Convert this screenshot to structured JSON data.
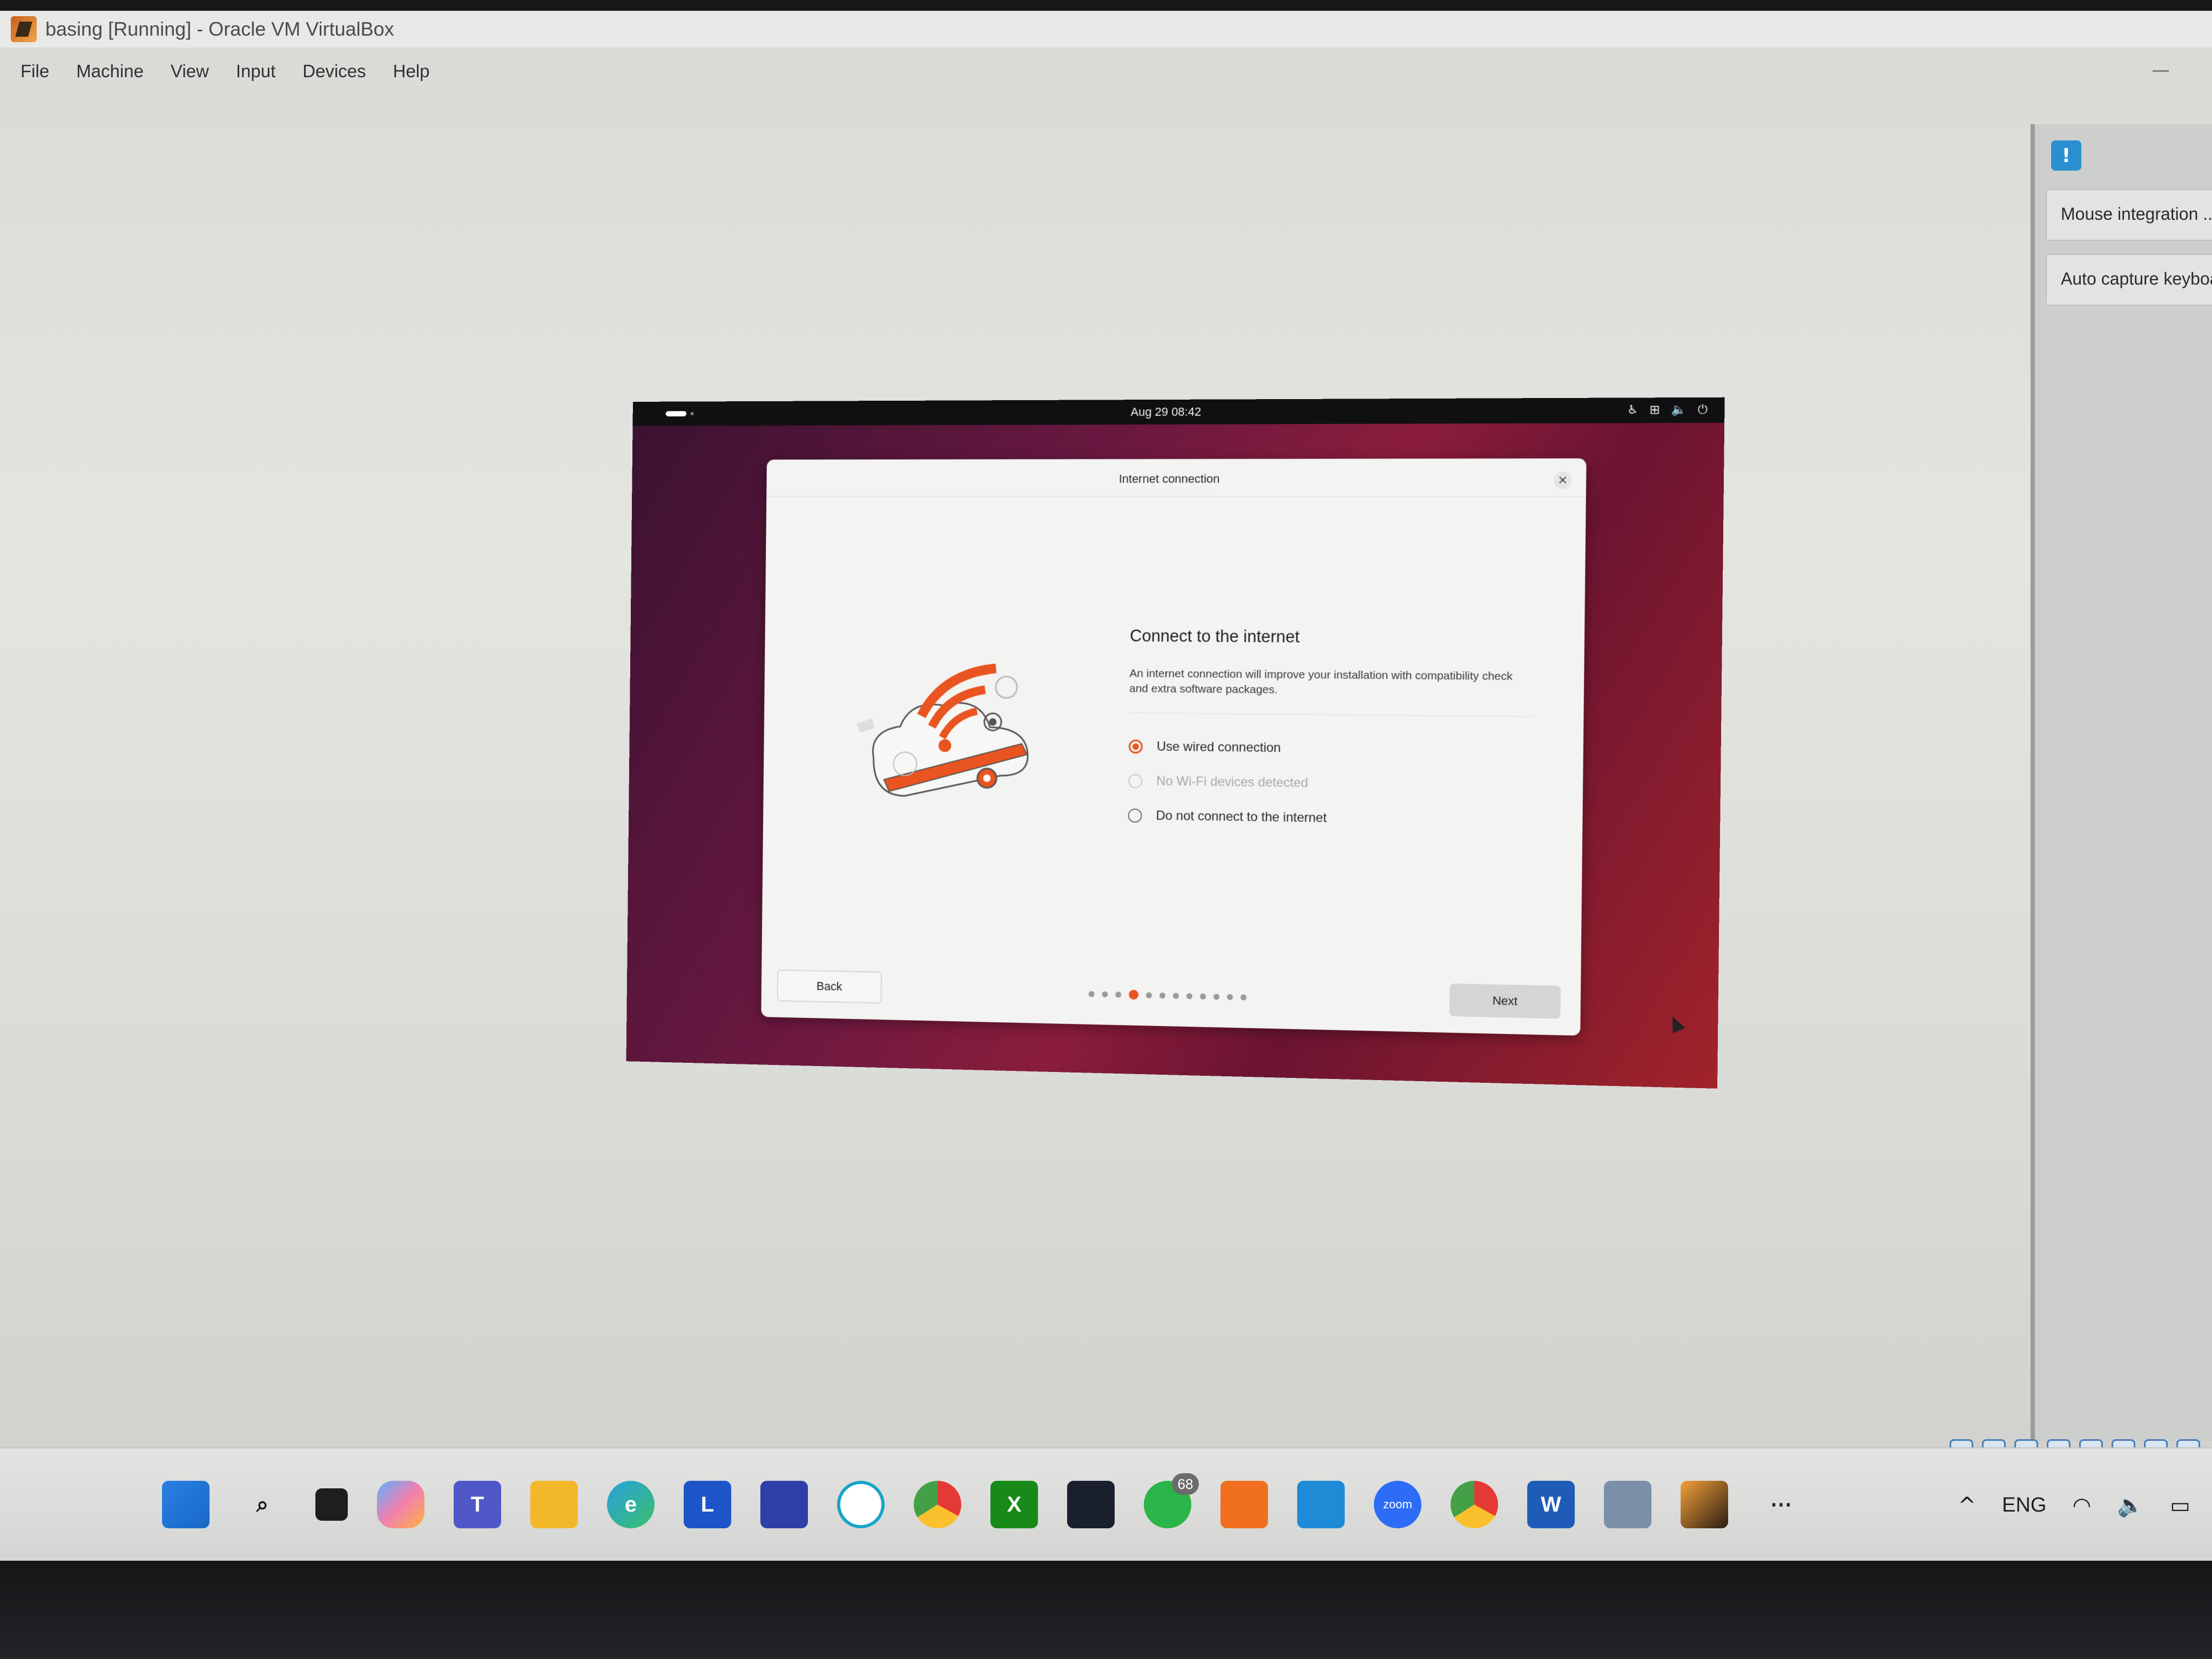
{
  "window": {
    "title": "basing [Running] - Oracle VM VirtualBox",
    "menu": [
      "File",
      "Machine",
      "View",
      "Input",
      "Devices",
      "Help"
    ]
  },
  "notifications": {
    "items": [
      "Mouse integration ...",
      "Auto capture keyboa"
    ]
  },
  "guest": {
    "topbar": {
      "clock": "Aug 29  08:42"
    },
    "dialog": {
      "title": "Internet connection",
      "heading": "Connect to the internet",
      "description": "An internet connection will improve your installation with compatibility check and extra software packages.",
      "options": [
        {
          "label": "Use wired connection",
          "selected": true,
          "disabled": false
        },
        {
          "label": "No Wi-Fi devices detected",
          "selected": false,
          "disabled": true
        },
        {
          "label": "Do not connect to the internet",
          "selected": false,
          "disabled": false
        }
      ],
      "back_label": "Back",
      "next_label": "Next",
      "pager": {
        "total": 12,
        "current_index": 3
      },
      "accent_color": "#e95420"
    }
  },
  "taskbar": {
    "whatsapp_badge": "68",
    "language": "ENG",
    "icons": [
      "windows-start",
      "search",
      "task-view",
      "copilot",
      "teams",
      "file-explorer",
      "edge",
      "l-app",
      "microsoft-store",
      "cortana",
      "chrome",
      "xbox",
      "media-app",
      "whatsapp",
      "xampp",
      "vscode",
      "zoom",
      "chrome-profile",
      "word",
      "virtualbox",
      "virtualbox-vm",
      "more"
    ],
    "zoom_label": "zoom"
  }
}
